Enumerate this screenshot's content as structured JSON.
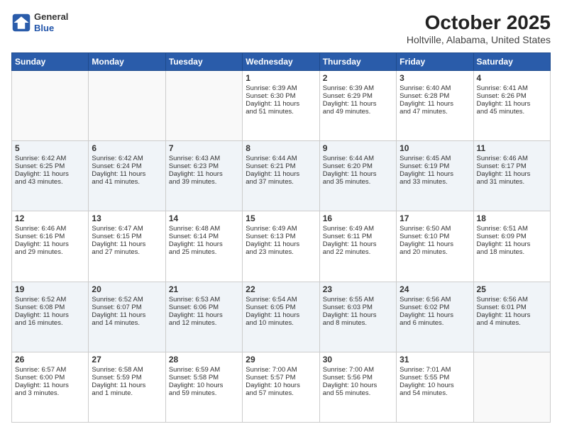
{
  "header": {
    "logo_general": "General",
    "logo_blue": "Blue",
    "title": "October 2025",
    "subtitle": "Holtville, Alabama, United States"
  },
  "weekdays": [
    "Sunday",
    "Monday",
    "Tuesday",
    "Wednesday",
    "Thursday",
    "Friday",
    "Saturday"
  ],
  "weeks": [
    [
      {
        "day": "",
        "info": ""
      },
      {
        "day": "",
        "info": ""
      },
      {
        "day": "",
        "info": ""
      },
      {
        "day": "1",
        "info": "Sunrise: 6:39 AM\nSunset: 6:30 PM\nDaylight: 11 hours\nand 51 minutes."
      },
      {
        "day": "2",
        "info": "Sunrise: 6:39 AM\nSunset: 6:29 PM\nDaylight: 11 hours\nand 49 minutes."
      },
      {
        "day": "3",
        "info": "Sunrise: 6:40 AM\nSunset: 6:28 PM\nDaylight: 11 hours\nand 47 minutes."
      },
      {
        "day": "4",
        "info": "Sunrise: 6:41 AM\nSunset: 6:26 PM\nDaylight: 11 hours\nand 45 minutes."
      }
    ],
    [
      {
        "day": "5",
        "info": "Sunrise: 6:42 AM\nSunset: 6:25 PM\nDaylight: 11 hours\nand 43 minutes."
      },
      {
        "day": "6",
        "info": "Sunrise: 6:42 AM\nSunset: 6:24 PM\nDaylight: 11 hours\nand 41 minutes."
      },
      {
        "day": "7",
        "info": "Sunrise: 6:43 AM\nSunset: 6:23 PM\nDaylight: 11 hours\nand 39 minutes."
      },
      {
        "day": "8",
        "info": "Sunrise: 6:44 AM\nSunset: 6:21 PM\nDaylight: 11 hours\nand 37 minutes."
      },
      {
        "day": "9",
        "info": "Sunrise: 6:44 AM\nSunset: 6:20 PM\nDaylight: 11 hours\nand 35 minutes."
      },
      {
        "day": "10",
        "info": "Sunrise: 6:45 AM\nSunset: 6:19 PM\nDaylight: 11 hours\nand 33 minutes."
      },
      {
        "day": "11",
        "info": "Sunrise: 6:46 AM\nSunset: 6:17 PM\nDaylight: 11 hours\nand 31 minutes."
      }
    ],
    [
      {
        "day": "12",
        "info": "Sunrise: 6:46 AM\nSunset: 6:16 PM\nDaylight: 11 hours\nand 29 minutes."
      },
      {
        "day": "13",
        "info": "Sunrise: 6:47 AM\nSunset: 6:15 PM\nDaylight: 11 hours\nand 27 minutes."
      },
      {
        "day": "14",
        "info": "Sunrise: 6:48 AM\nSunset: 6:14 PM\nDaylight: 11 hours\nand 25 minutes."
      },
      {
        "day": "15",
        "info": "Sunrise: 6:49 AM\nSunset: 6:13 PM\nDaylight: 11 hours\nand 23 minutes."
      },
      {
        "day": "16",
        "info": "Sunrise: 6:49 AM\nSunset: 6:11 PM\nDaylight: 11 hours\nand 22 minutes."
      },
      {
        "day": "17",
        "info": "Sunrise: 6:50 AM\nSunset: 6:10 PM\nDaylight: 11 hours\nand 20 minutes."
      },
      {
        "day": "18",
        "info": "Sunrise: 6:51 AM\nSunset: 6:09 PM\nDaylight: 11 hours\nand 18 minutes."
      }
    ],
    [
      {
        "day": "19",
        "info": "Sunrise: 6:52 AM\nSunset: 6:08 PM\nDaylight: 11 hours\nand 16 minutes."
      },
      {
        "day": "20",
        "info": "Sunrise: 6:52 AM\nSunset: 6:07 PM\nDaylight: 11 hours\nand 14 minutes."
      },
      {
        "day": "21",
        "info": "Sunrise: 6:53 AM\nSunset: 6:06 PM\nDaylight: 11 hours\nand 12 minutes."
      },
      {
        "day": "22",
        "info": "Sunrise: 6:54 AM\nSunset: 6:05 PM\nDaylight: 11 hours\nand 10 minutes."
      },
      {
        "day": "23",
        "info": "Sunrise: 6:55 AM\nSunset: 6:03 PM\nDaylight: 11 hours\nand 8 minutes."
      },
      {
        "day": "24",
        "info": "Sunrise: 6:56 AM\nSunset: 6:02 PM\nDaylight: 11 hours\nand 6 minutes."
      },
      {
        "day": "25",
        "info": "Sunrise: 6:56 AM\nSunset: 6:01 PM\nDaylight: 11 hours\nand 4 minutes."
      }
    ],
    [
      {
        "day": "26",
        "info": "Sunrise: 6:57 AM\nSunset: 6:00 PM\nDaylight: 11 hours\nand 3 minutes."
      },
      {
        "day": "27",
        "info": "Sunrise: 6:58 AM\nSunset: 5:59 PM\nDaylight: 11 hours\nand 1 minute."
      },
      {
        "day": "28",
        "info": "Sunrise: 6:59 AM\nSunset: 5:58 PM\nDaylight: 10 hours\nand 59 minutes."
      },
      {
        "day": "29",
        "info": "Sunrise: 7:00 AM\nSunset: 5:57 PM\nDaylight: 10 hours\nand 57 minutes."
      },
      {
        "day": "30",
        "info": "Sunrise: 7:00 AM\nSunset: 5:56 PM\nDaylight: 10 hours\nand 55 minutes."
      },
      {
        "day": "31",
        "info": "Sunrise: 7:01 AM\nSunset: 5:55 PM\nDaylight: 10 hours\nand 54 minutes."
      },
      {
        "day": "",
        "info": ""
      }
    ]
  ]
}
